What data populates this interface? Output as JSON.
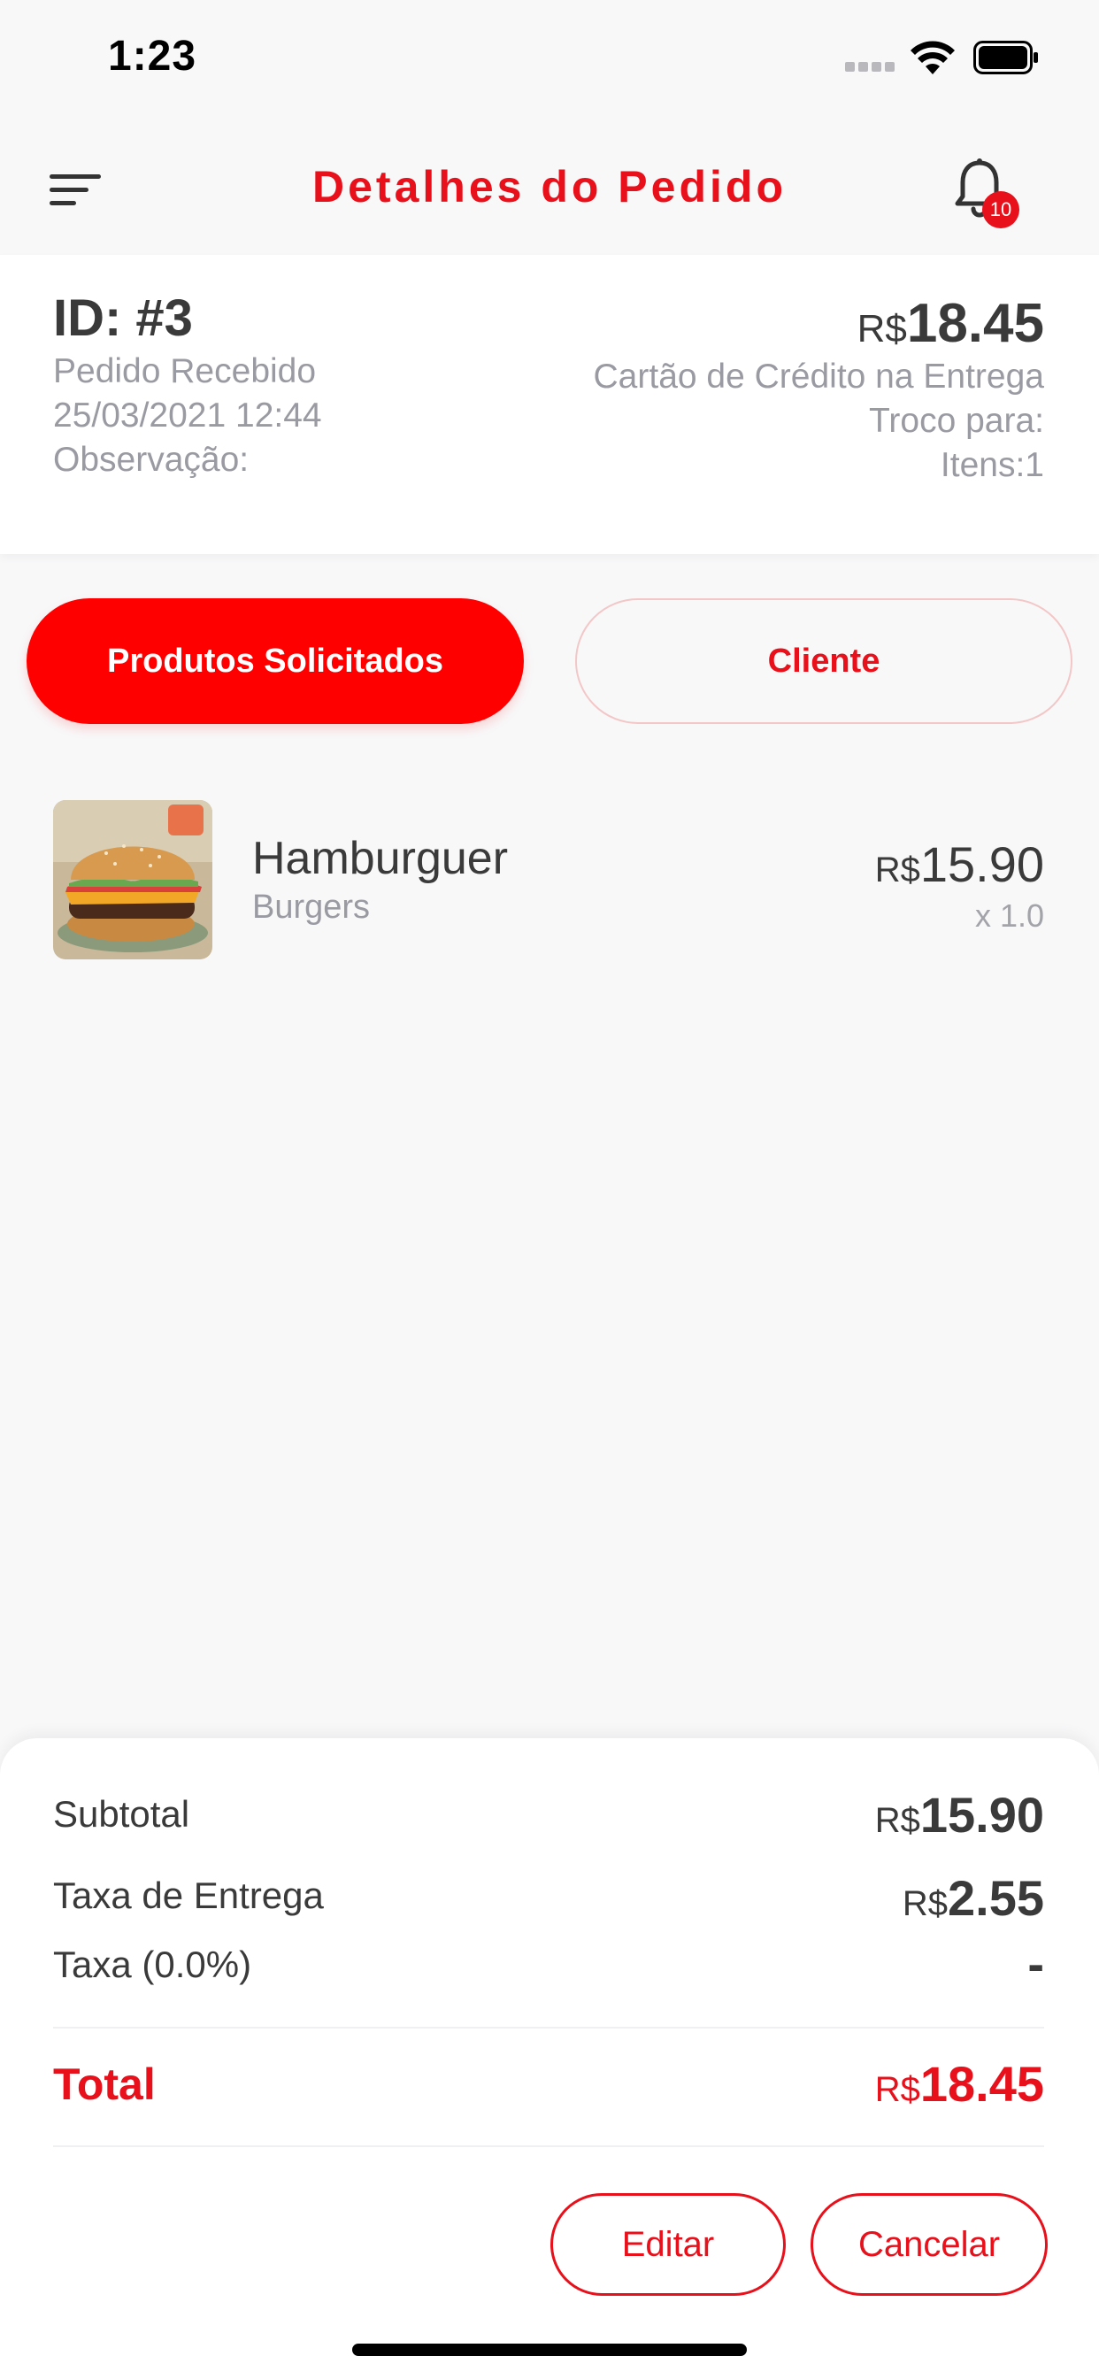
{
  "status_bar": {
    "time": "1:23"
  },
  "header": {
    "title": "Detalhes do Pedido",
    "notification_count": "10"
  },
  "order": {
    "id": "ID: #3",
    "status": "Pedido Recebido",
    "datetime": "25/03/2021 12:44",
    "observation_label": "Observação:",
    "amount_currency": "R$",
    "amount_value": "18.45",
    "payment_method": "Cartão de Crédito na Entrega",
    "change_label": "Troco para:",
    "items_label": "Itens:1"
  },
  "tabs": [
    {
      "label": "Produtos Solicitados",
      "active": true
    },
    {
      "label": "Cliente",
      "active": false
    }
  ],
  "products": [
    {
      "name": "Hamburguer",
      "category": "Burgers",
      "currency": "R$",
      "price": "15.90",
      "quantity": "x 1.0"
    }
  ],
  "summary": {
    "subtotal_label": "Subtotal",
    "subtotal_currency": "R$",
    "subtotal_value": "15.90",
    "delivery_label": "Taxa de Entrega",
    "delivery_currency": "R$",
    "delivery_value": "2.55",
    "tax_label": "Taxa (0.0%)",
    "tax_value": "-",
    "total_label": "Total",
    "total_currency": "R$",
    "total_value": "18.45"
  },
  "actions": {
    "edit_label": "Editar",
    "cancel_label": "Cancelar"
  },
  "colors": {
    "accent": "#e8101a",
    "primary_button": "#ff0000"
  }
}
